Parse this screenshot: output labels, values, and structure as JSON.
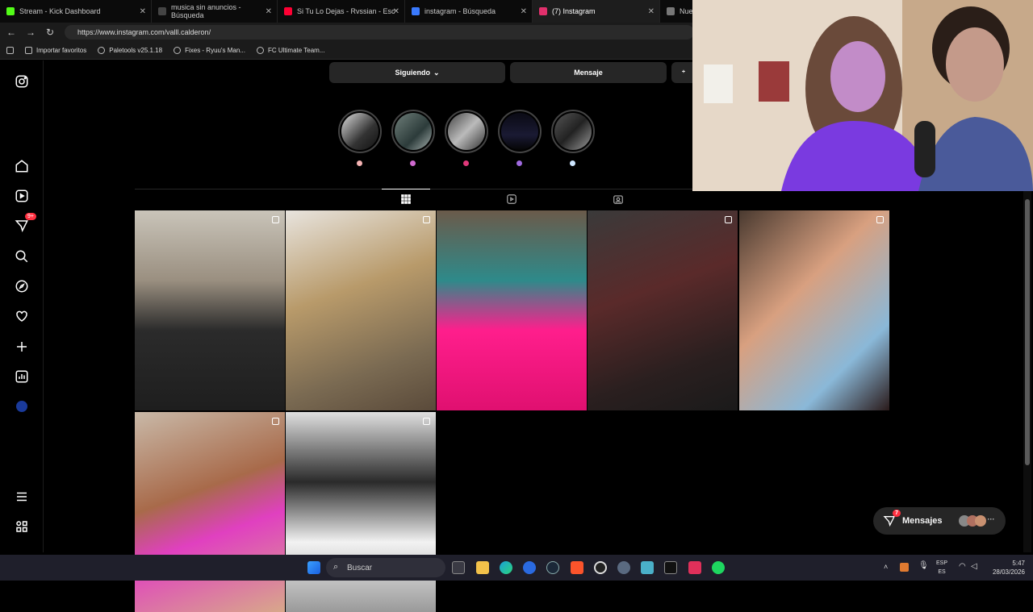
{
  "browser": {
    "tabs": [
      {
        "label": "Stream - Kick Dashboard",
        "color": "#53fc18"
      },
      {
        "label": "musica sin anuncios - Búsqueda",
        "color": "#333333"
      },
      {
        "label": "Si Tu Lo Dejas - Rvssian - Esc",
        "color": "#ff0033"
      },
      {
        "label": "instagram - Búsqueda",
        "color": "#3a7afe"
      },
      {
        "label": "(7) Instagram",
        "color": "#e1306c"
      },
      {
        "label": "Nue",
        "color": "#777777"
      }
    ],
    "url": "https://www.instagram.com/valll.calderon/",
    "bookmarks": [
      "Importar favoritos",
      "Paletools v25.1.18",
      "Fixes - Ryuu's Man...",
      "FC Ultimate Team..."
    ]
  },
  "profile": {
    "following_label": "Siguiendo",
    "message_label": "Mensaje"
  },
  "sidebar": {
    "notifications_badge": "9+"
  },
  "messages_pill": {
    "label": "Mensajes",
    "badge": "7"
  },
  "taskbar": {
    "search_placeholder": "Buscar",
    "lang_top": "ESP",
    "lang_bottom": "ES",
    "time": "5:47",
    "date": "28/03/2026"
  }
}
